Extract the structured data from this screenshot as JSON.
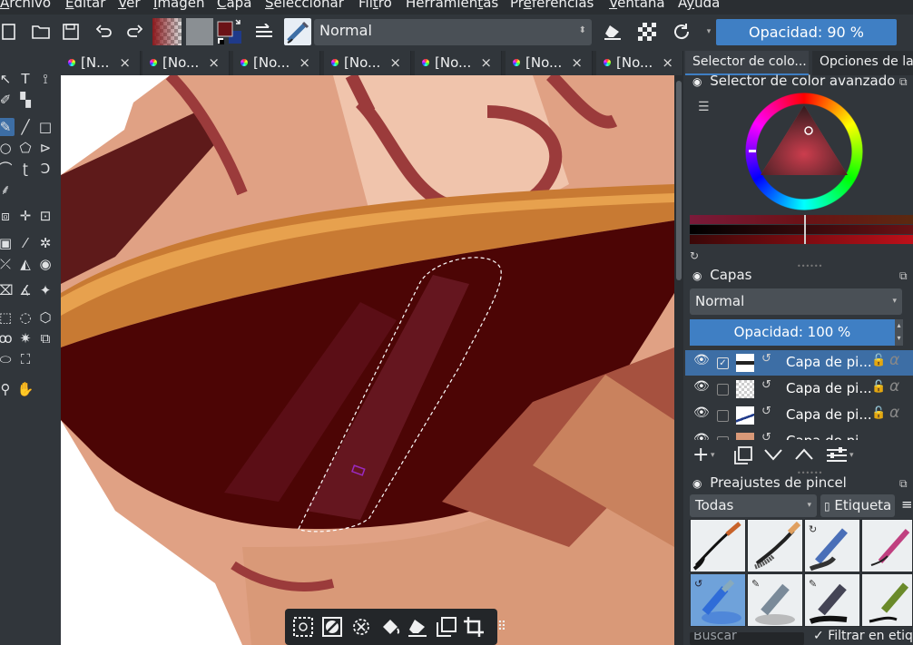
{
  "menu": [
    {
      "label": "Archivo"
    },
    {
      "label": "Editar"
    },
    {
      "label": "Ver"
    },
    {
      "label": "Imagen"
    },
    {
      "label": "Capa"
    },
    {
      "label": "Seleccionar"
    },
    {
      "label": "Filtro"
    },
    {
      "label": "Herramientas"
    },
    {
      "label": "Preferencias"
    },
    {
      "label": "Ventana"
    },
    {
      "label": "Ayuda"
    }
  ],
  "toolbar": {
    "blend_mode": "Normal",
    "opacity": "Opacidad: 90 %",
    "icons": [
      "new-document-icon",
      "open-folder-icon",
      "save-icon",
      "undo-icon",
      "redo-icon",
      "gradient-swatch-icon",
      "pattern-swatch-icon",
      "fg-bg-color-icon",
      "brush-settings-icon",
      "brush-preset-icon",
      "eraser-icon",
      "alpha-lock-icon",
      "reload-icon"
    ]
  },
  "tabs": [
    {
      "label": "[N...",
      "close": "×"
    },
    {
      "label": "[No...",
      "close": "×"
    },
    {
      "label": "[No...",
      "close": "×"
    },
    {
      "label": "[No...",
      "close": "×"
    },
    {
      "label": "[No...",
      "close": "×"
    },
    {
      "label": "[No...",
      "close": "×"
    },
    {
      "label": "[No...",
      "close": "×"
    }
  ],
  "dock": {
    "tabs": [
      "Selector de colo...",
      "Opciones de la"
    ],
    "color_panel_title": "Selector de color avanzado",
    "layers": {
      "title": "Capas",
      "blend_mode": "Normal",
      "opacity": "Opacidad: 100 %",
      "rows": [
        {
          "name": "Capa de pi...",
          "selected": true,
          "checked": true
        },
        {
          "name": "Capa de pi...",
          "selected": false,
          "checked": false
        },
        {
          "name": "Capa de pi...",
          "selected": false,
          "checked": false
        },
        {
          "name": "Capa de pi...",
          "selected": false,
          "checked": false
        }
      ]
    },
    "brushes": {
      "title": "Preajustes de pincel",
      "filter": "Todas",
      "tag_button": "Etiqueta",
      "search_placeholder": "Buscar",
      "filter_tag_label": "Filtrar en etique"
    }
  },
  "colors": {
    "accent": "#3f7fc4",
    "selected_row": "#3d6ea5",
    "panel_bg": "#31363b",
    "fg_color": "#6b1216",
    "bg_color": "#1f3a8a"
  }
}
